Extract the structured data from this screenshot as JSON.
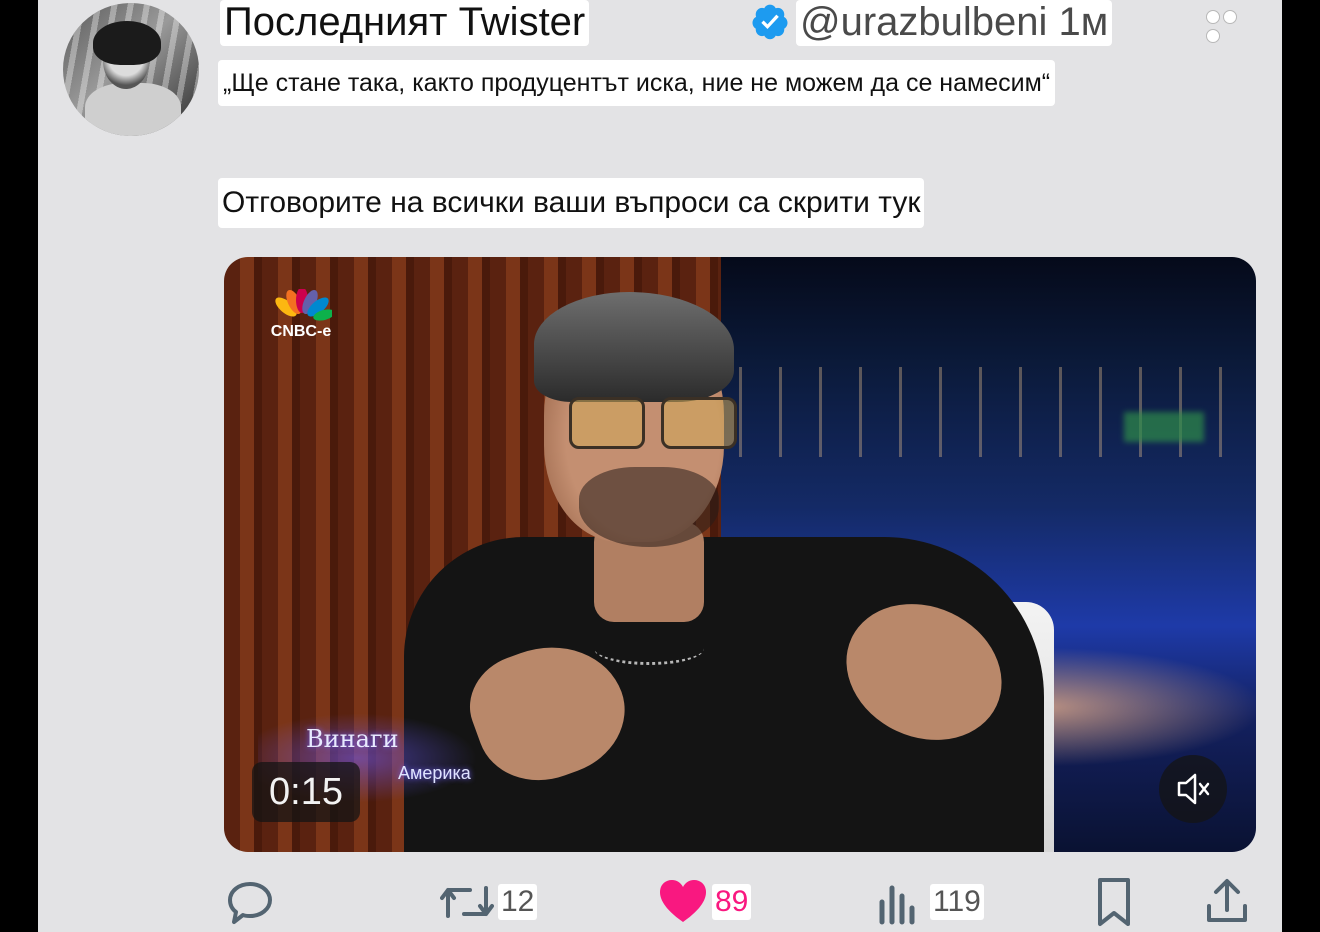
{
  "author": {
    "display_name": "Последният Twister",
    "handle": "@urazbulbeni 1м"
  },
  "tweet": {
    "line1": "„Ще стане така, както продуцентът иска, ние не можем да се намесим“",
    "line2": "Отговорите на всички ваши въпроси са скрити тук"
  },
  "video": {
    "channel_logo": "CNBC-e",
    "show_title_1": "Винаги",
    "show_title_2": "Америка",
    "timer": "0:15",
    "mute_icon": "speaker-muted-icon"
  },
  "actions": {
    "reply_icon": "reply-icon",
    "retweet_icon": "retweet-icon",
    "retweet_count": "12",
    "like_icon": "heart-icon",
    "like_count": "89",
    "views_icon": "views-icon",
    "views_count": "119",
    "bookmark_icon": "bookmark-icon",
    "share_icon": "share-icon"
  },
  "colors": {
    "background": "#e3e3e5",
    "verified": "#1d9bf0",
    "like": "#f91880",
    "icon": "#536471"
  }
}
